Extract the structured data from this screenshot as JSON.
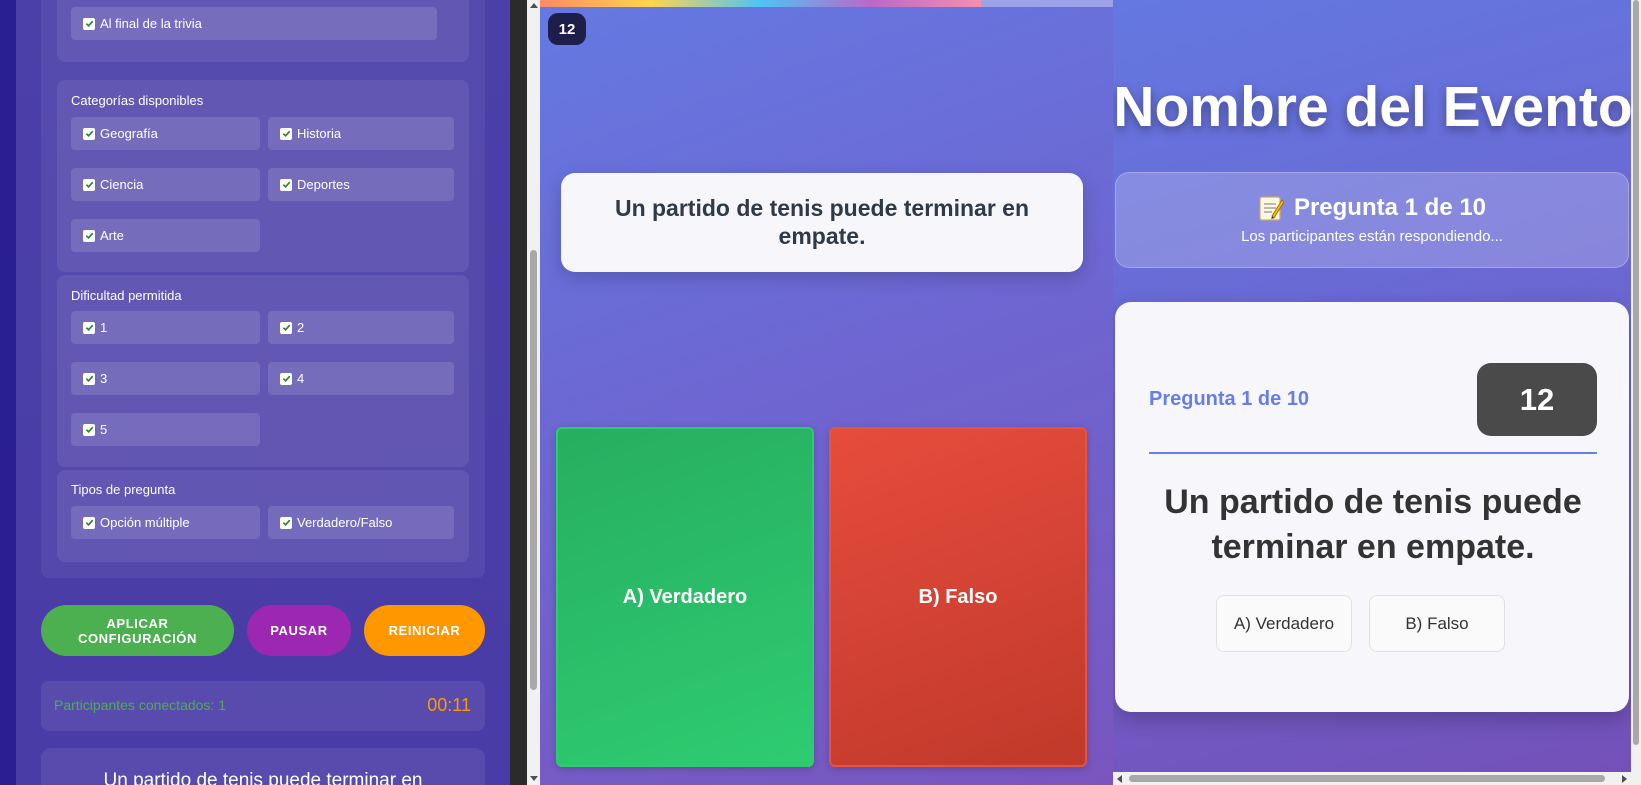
{
  "admin": {
    "end_option": "Al final de la trivia",
    "categories": {
      "title": "Categorías disponibles",
      "items": [
        "Geografía",
        "Historia",
        "Ciencia",
        "Deportes",
        "Arte"
      ]
    },
    "difficulty": {
      "title": "Dificultad permitida",
      "items": [
        "1",
        "2",
        "3",
        "4",
        "5"
      ]
    },
    "question_types": {
      "title": "Tipos de pregunta",
      "items": [
        "Opción múltiple",
        "Verdadero/Falso"
      ]
    },
    "buttons": {
      "apply": "APLICAR CONFIGURACIÓN",
      "pause": "PAUSAR",
      "reset": "REINICIAR"
    },
    "status": {
      "participants": "Participantes conectados: 1",
      "time": "00:11"
    },
    "preview_question": "Un partido de tenis puede terminar en"
  },
  "player": {
    "timer_badge": "12",
    "question": "Un partido de tenis puede terminar en empate.",
    "answers": [
      "A) Verdadero",
      "B) Falso"
    ],
    "progress": 0.77
  },
  "display": {
    "event_name": "Nombre del Evento",
    "status_heading": "Pregunta 1 de 10",
    "status_sub": "Los participantes están respondiendo...",
    "question_number": "Pregunta 1 de 10",
    "timer": "12",
    "question": "Un partido de tenis puede terminar en empate.",
    "options": [
      "A) Verdadero",
      "B) Falso"
    ]
  },
  "colors": {
    "accent": "#667eea",
    "apply": "#4caf50",
    "pause": "#9c27b0",
    "reset": "#ff9800",
    "true_answer": "#2ecc71",
    "false_answer": "#e74c3c"
  },
  "icons": [
    "check-icon",
    "memo-icon"
  ]
}
